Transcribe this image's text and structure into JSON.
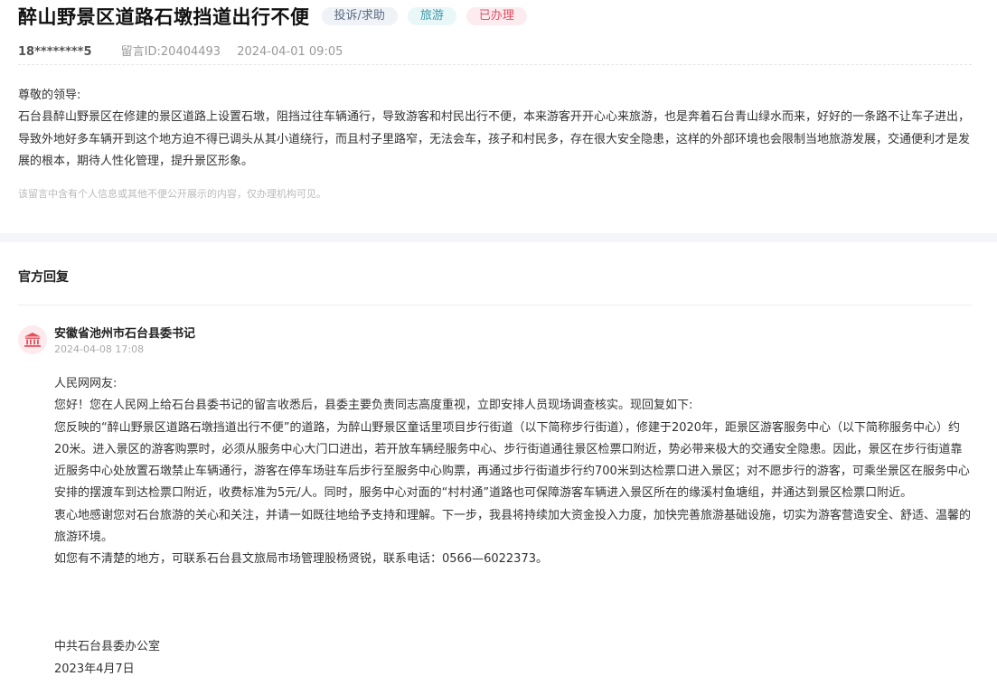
{
  "message": {
    "title": "醉山野景区道路石墩挡道出行不便",
    "tags": [
      "投诉/求助",
      "旅游",
      "已办理"
    ],
    "user": "18********5",
    "id_label": "留言ID:20404493",
    "datetime": "2024-04-01 09:05",
    "greeting": "尊敬的领导:",
    "content": "石台县醉山野景区在修建的景区道路上设置石墩，阻挡过往车辆通行，导致游客和村民出行不便，本来游客开开心心来旅游，也是奔着石台青山绿水而来，好好的一条路不让车子进出，导致外地好多车辆开到这个地方迫不得已调头从其小道绕行，而且村子里路窄，无法会车，孩子和村民多，存在很大安全隐患，这样的外部环境也会限制当地旅游发展，交通便利才是发展的根本，期待人性化管理，提升景区形象。",
    "notice": "该留言中含有个人信息或其他不便公开展示的内容，仅办理机构可见。"
  },
  "reply": {
    "heading": "官方回复",
    "org": "安徽省池州市石台县委书记",
    "date": "2024-04-08 17:08",
    "paragraphs": [
      "人民网网友:",
      "您好！您在人民网上给石台县委书记的留言收悉后，县委主要负责同志高度重视，立即安排人员现场调查核实。现回复如下:",
      "您反映的“醉山野景区道路石墩挡道出行不便”的道路，为醉山野景区童话里项目步行街道（以下简称步行街道），修建于2020年，距景区游客服务中心（以下简称服务中心）约20米。进入景区的游客购票时，必须从服务中心大门口进出，若开放车辆经服务中心、步行街道通往景区检票口附近，势必带来极大的交通安全隐患。因此，景区在步行街道靠近服务中心处放置石墩禁止车辆通行，游客在停车场驻车后步行至服务中心购票，再通过步行街道步行约700米到达检票口进入景区；对不愿步行的游客，可乘坐景区在服务中心安排的摆渡车到达检票口附近，收费标准为5元/人。同时，服务中心对面的“村村通”道路也可保障游客车辆进入景区所在的缘溪村鱼塘组，并通达到景区检票口附近。",
      "衷心地感谢您对石台旅游的关心和关注，并请一如既往地给予支持和理解。下一步，我县将持续加大资金投入力度，加快完善旅游基础设施，切实为游客营造安全、舒适、温馨的旅游环境。",
      "如您有不清楚的地方，可联系石台县文旅局市场管理股杨贤锐，联系电话：0566—6022373。"
    ],
    "signature_org": "中共石台县委办公室",
    "signature_date": "2023年4月7日"
  },
  "colors": {
    "tag_complaint": "#5a6c84",
    "tag_travel": "#3a97a7",
    "tag_done": "#e25066",
    "avatar_icon": "#e6505e"
  },
  "icons": {
    "avatar": "government-building-icon"
  }
}
